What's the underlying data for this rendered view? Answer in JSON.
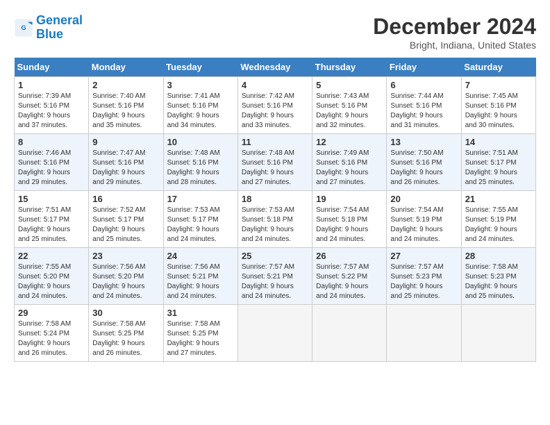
{
  "logo": {
    "line1": "General",
    "line2": "Blue"
  },
  "title": "December 2024",
  "location": "Bright, Indiana, United States",
  "days_of_week": [
    "Sunday",
    "Monday",
    "Tuesday",
    "Wednesday",
    "Thursday",
    "Friday",
    "Saturday"
  ],
  "weeks": [
    [
      {
        "day": "1",
        "info": "Sunrise: 7:39 AM\nSunset: 5:16 PM\nDaylight: 9 hours\nand 37 minutes."
      },
      {
        "day": "2",
        "info": "Sunrise: 7:40 AM\nSunset: 5:16 PM\nDaylight: 9 hours\nand 35 minutes."
      },
      {
        "day": "3",
        "info": "Sunrise: 7:41 AM\nSunset: 5:16 PM\nDaylight: 9 hours\nand 34 minutes."
      },
      {
        "day": "4",
        "info": "Sunrise: 7:42 AM\nSunset: 5:16 PM\nDaylight: 9 hours\nand 33 minutes."
      },
      {
        "day": "5",
        "info": "Sunrise: 7:43 AM\nSunset: 5:16 PM\nDaylight: 9 hours\nand 32 minutes."
      },
      {
        "day": "6",
        "info": "Sunrise: 7:44 AM\nSunset: 5:16 PM\nDaylight: 9 hours\nand 31 minutes."
      },
      {
        "day": "7",
        "info": "Sunrise: 7:45 AM\nSunset: 5:16 PM\nDaylight: 9 hours\nand 30 minutes."
      }
    ],
    [
      {
        "day": "8",
        "info": "Sunrise: 7:46 AM\nSunset: 5:16 PM\nDaylight: 9 hours\nand 29 minutes."
      },
      {
        "day": "9",
        "info": "Sunrise: 7:47 AM\nSunset: 5:16 PM\nDaylight: 9 hours\nand 29 minutes."
      },
      {
        "day": "10",
        "info": "Sunrise: 7:48 AM\nSunset: 5:16 PM\nDaylight: 9 hours\nand 28 minutes."
      },
      {
        "day": "11",
        "info": "Sunrise: 7:48 AM\nSunset: 5:16 PM\nDaylight: 9 hours\nand 27 minutes."
      },
      {
        "day": "12",
        "info": "Sunrise: 7:49 AM\nSunset: 5:16 PM\nDaylight: 9 hours\nand 27 minutes."
      },
      {
        "day": "13",
        "info": "Sunrise: 7:50 AM\nSunset: 5:16 PM\nDaylight: 9 hours\nand 26 minutes."
      },
      {
        "day": "14",
        "info": "Sunrise: 7:51 AM\nSunset: 5:17 PM\nDaylight: 9 hours\nand 25 minutes."
      }
    ],
    [
      {
        "day": "15",
        "info": "Sunrise: 7:51 AM\nSunset: 5:17 PM\nDaylight: 9 hours\nand 25 minutes."
      },
      {
        "day": "16",
        "info": "Sunrise: 7:52 AM\nSunset: 5:17 PM\nDaylight: 9 hours\nand 25 minutes."
      },
      {
        "day": "17",
        "info": "Sunrise: 7:53 AM\nSunset: 5:17 PM\nDaylight: 9 hours\nand 24 minutes."
      },
      {
        "day": "18",
        "info": "Sunrise: 7:53 AM\nSunset: 5:18 PM\nDaylight: 9 hours\nand 24 minutes."
      },
      {
        "day": "19",
        "info": "Sunrise: 7:54 AM\nSunset: 5:18 PM\nDaylight: 9 hours\nand 24 minutes."
      },
      {
        "day": "20",
        "info": "Sunrise: 7:54 AM\nSunset: 5:19 PM\nDaylight: 9 hours\nand 24 minutes."
      },
      {
        "day": "21",
        "info": "Sunrise: 7:55 AM\nSunset: 5:19 PM\nDaylight: 9 hours\nand 24 minutes."
      }
    ],
    [
      {
        "day": "22",
        "info": "Sunrise: 7:55 AM\nSunset: 5:20 PM\nDaylight: 9 hours\nand 24 minutes."
      },
      {
        "day": "23",
        "info": "Sunrise: 7:56 AM\nSunset: 5:20 PM\nDaylight: 9 hours\nand 24 minutes."
      },
      {
        "day": "24",
        "info": "Sunrise: 7:56 AM\nSunset: 5:21 PM\nDaylight: 9 hours\nand 24 minutes."
      },
      {
        "day": "25",
        "info": "Sunrise: 7:57 AM\nSunset: 5:21 PM\nDaylight: 9 hours\nand 24 minutes."
      },
      {
        "day": "26",
        "info": "Sunrise: 7:57 AM\nSunset: 5:22 PM\nDaylight: 9 hours\nand 24 minutes."
      },
      {
        "day": "27",
        "info": "Sunrise: 7:57 AM\nSunset: 5:23 PM\nDaylight: 9 hours\nand 25 minutes."
      },
      {
        "day": "28",
        "info": "Sunrise: 7:58 AM\nSunset: 5:23 PM\nDaylight: 9 hours\nand 25 minutes."
      }
    ],
    [
      {
        "day": "29",
        "info": "Sunrise: 7:58 AM\nSunset: 5:24 PM\nDaylight: 9 hours\nand 26 minutes."
      },
      {
        "day": "30",
        "info": "Sunrise: 7:58 AM\nSunset: 5:25 PM\nDaylight: 9 hours\nand 26 minutes."
      },
      {
        "day": "31",
        "info": "Sunrise: 7:58 AM\nSunset: 5:25 PM\nDaylight: 9 hours\nand 27 minutes."
      },
      {
        "day": "",
        "info": ""
      },
      {
        "day": "",
        "info": ""
      },
      {
        "day": "",
        "info": ""
      },
      {
        "day": "",
        "info": ""
      }
    ]
  ]
}
